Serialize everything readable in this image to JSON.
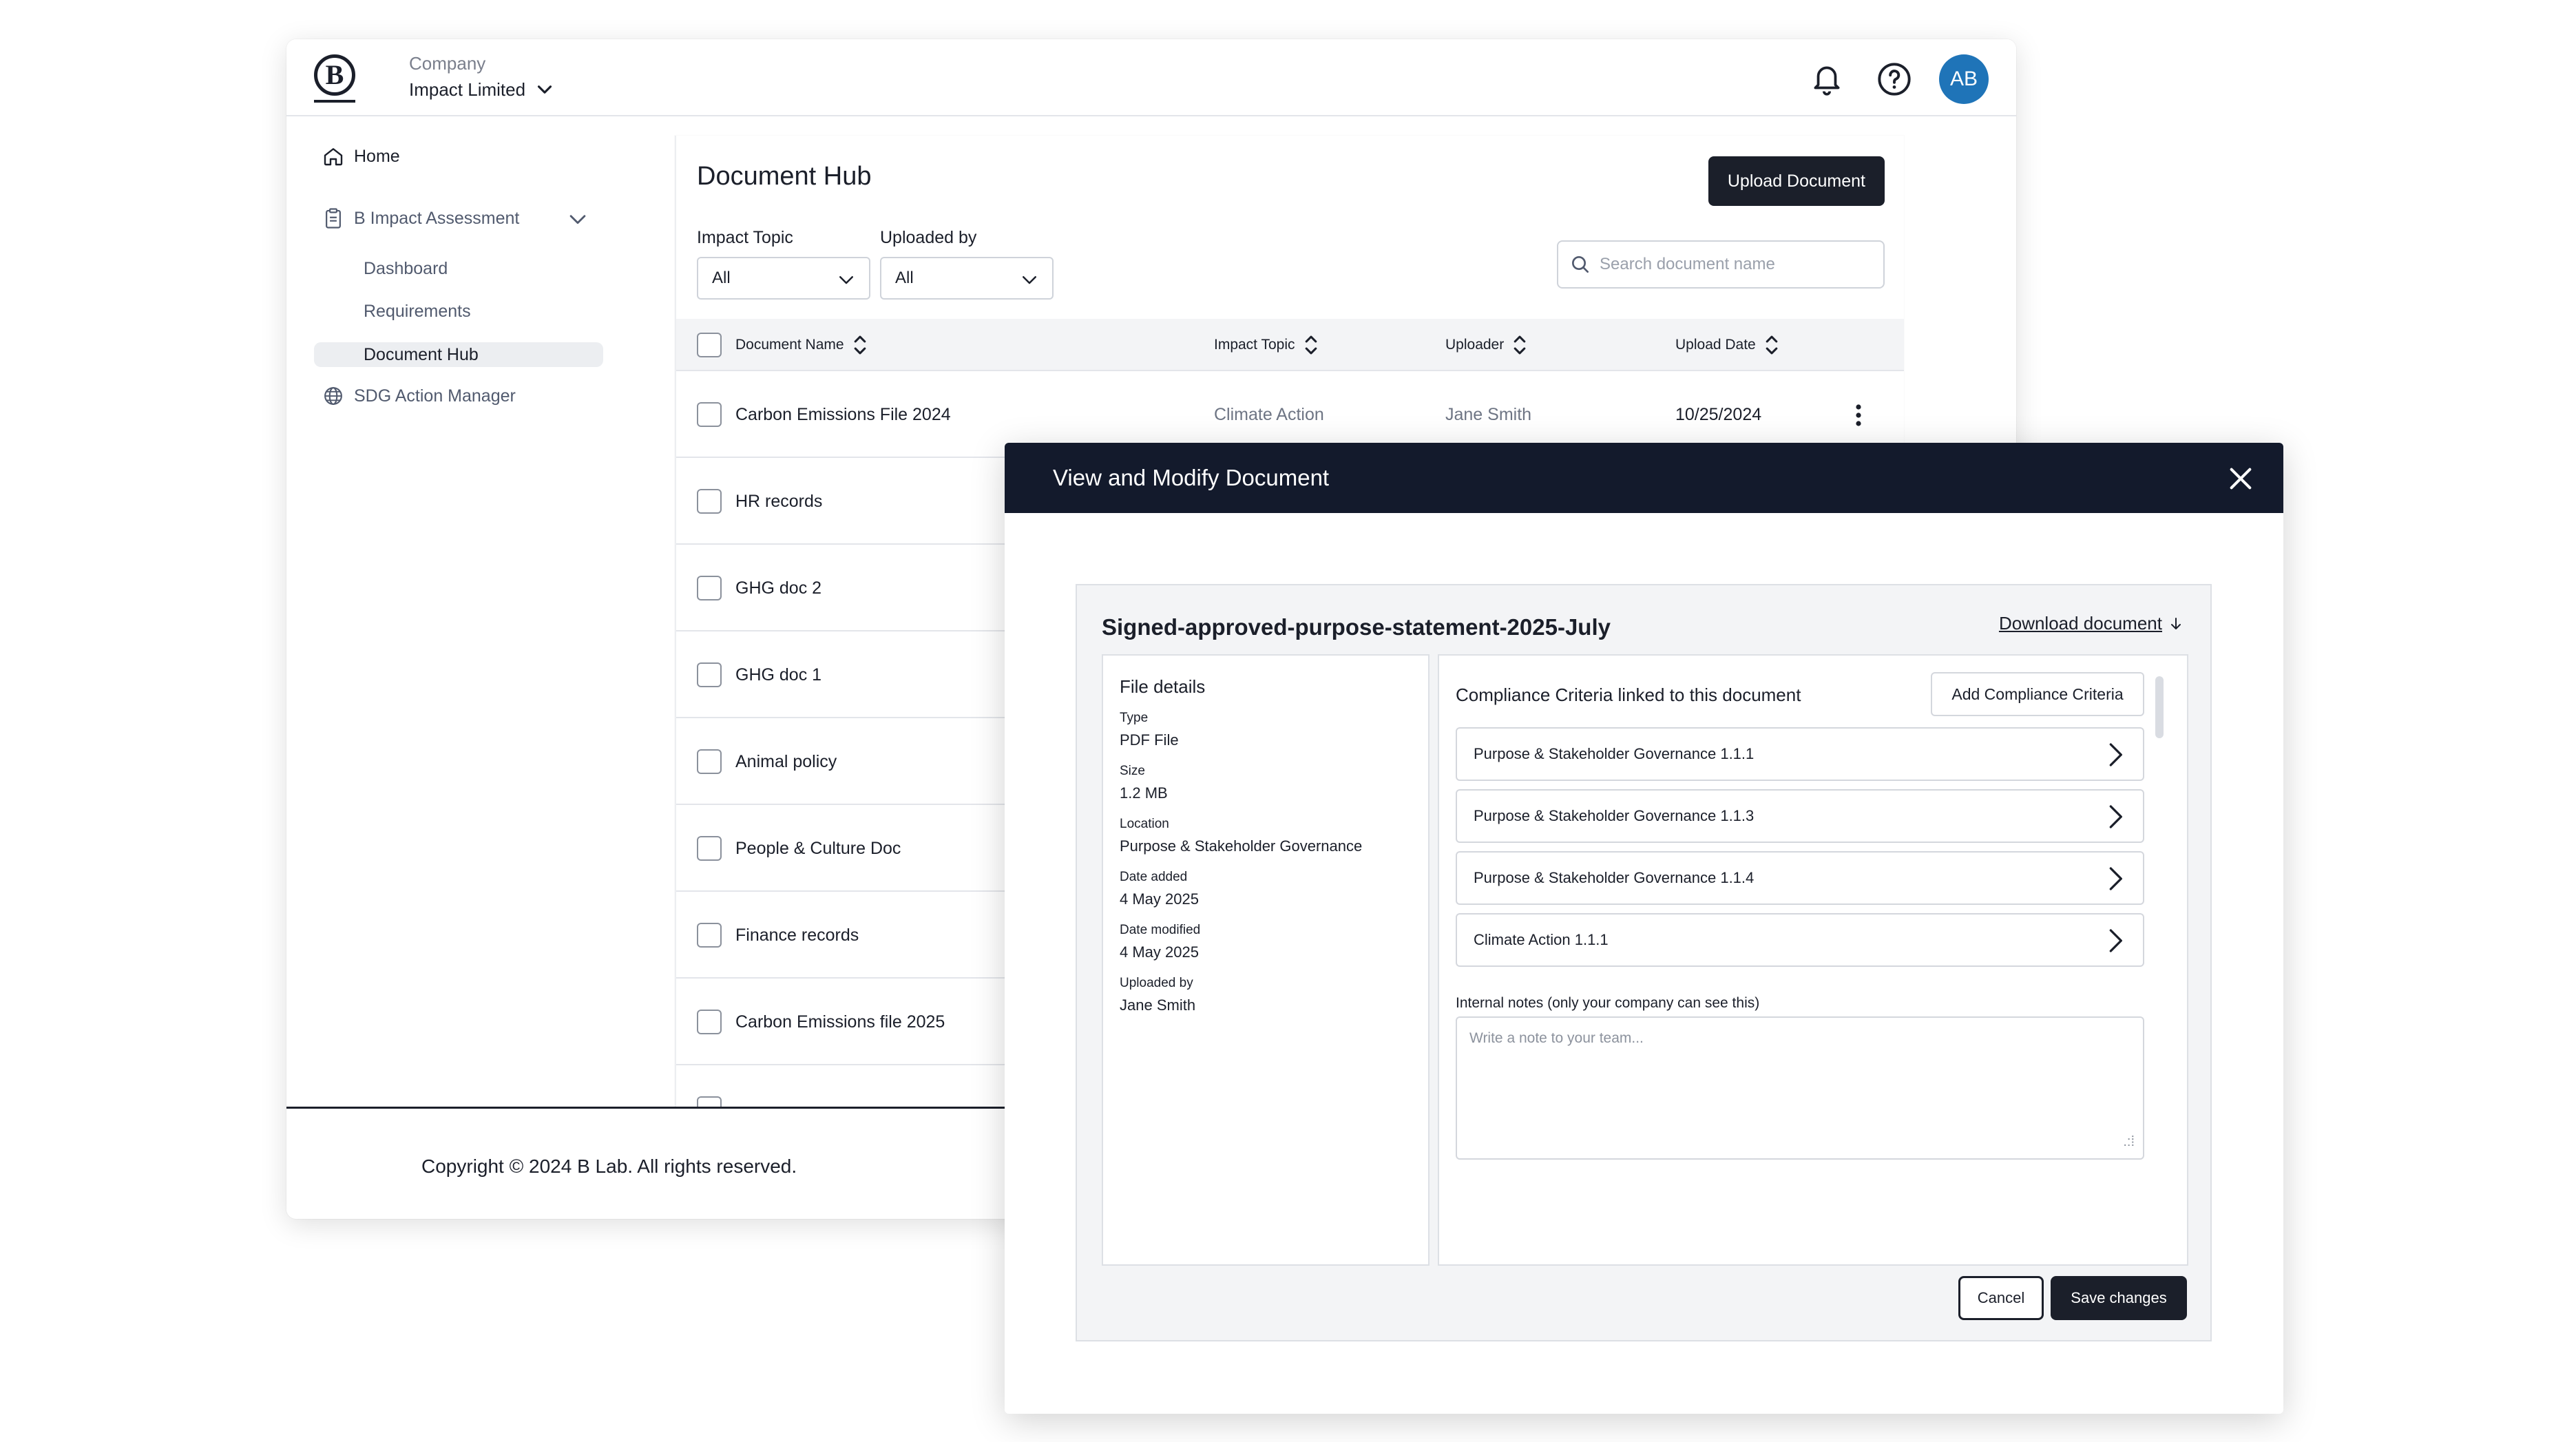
{
  "header": {
    "company_label": "Company",
    "company_name": "Impact Limited",
    "avatar_initials": "AB",
    "avatar_color": "#1f74b8"
  },
  "sidebar": {
    "home": "Home",
    "assessment": "B Impact Assessment",
    "sub_items": [
      "Dashboard",
      "Requirements",
      "Document Hub"
    ],
    "sdg": "SDG Action Manager"
  },
  "main": {
    "title": "Document Hub",
    "upload_button": "Upload Document",
    "filters": {
      "impact_topic_label": "Impact Topic",
      "impact_topic_value": "All",
      "uploaded_by_label": "Uploaded by",
      "uploaded_by_value": "All"
    },
    "search_placeholder": "Search document name",
    "columns": [
      "Document Name",
      "Impact Topic",
      "Uploader",
      "Upload Date"
    ],
    "rows": [
      {
        "name": "Carbon Emissions File 2024",
        "topic": "Climate Action",
        "uploader": "Jane Smith",
        "date": "10/25/2024"
      },
      {
        "name": "HR records"
      },
      {
        "name": "GHG doc 2"
      },
      {
        "name": "GHG doc 1"
      },
      {
        "name": "Animal policy"
      },
      {
        "name": "People & Culture Doc"
      },
      {
        "name": "Finance records"
      },
      {
        "name": "Carbon Emissions file 2025"
      }
    ]
  },
  "footer": {
    "copyright": "Copyright © 2024 B Lab. All rights reserved."
  },
  "modal": {
    "title": "View and Modify Document",
    "document_name": "Signed-approved-purpose-statement-2025-July",
    "download_label": "Download document",
    "file_details": {
      "heading": "File details",
      "fields": [
        {
          "key": "Type",
          "value": "PDF File"
        },
        {
          "key": "Size",
          "value": "1.2 MB"
        },
        {
          "key": "Location",
          "value": "Purpose & Stakeholder Governance"
        },
        {
          "key": "Date added",
          "value": "4 May 2025"
        },
        {
          "key": "Date modified",
          "value": "4 May 2025"
        },
        {
          "key": "Uploaded by",
          "value": "Jane Smith"
        }
      ]
    },
    "compliance": {
      "heading": "Compliance Criteria linked to this document",
      "add_button": "Add Compliance Criteria",
      "items": [
        "Purpose & Stakeholder Governance 1.1.1",
        "Purpose & Stakeholder Governance 1.1.3",
        "Purpose & Stakeholder Governance 1.1.4",
        "Climate Action 1.1.1"
      ],
      "notes_label": "Internal notes (only your company can see this)",
      "notes_placeholder": "Write a note to your team..."
    },
    "cancel_button": "Cancel",
    "save_button": "Save changes"
  }
}
